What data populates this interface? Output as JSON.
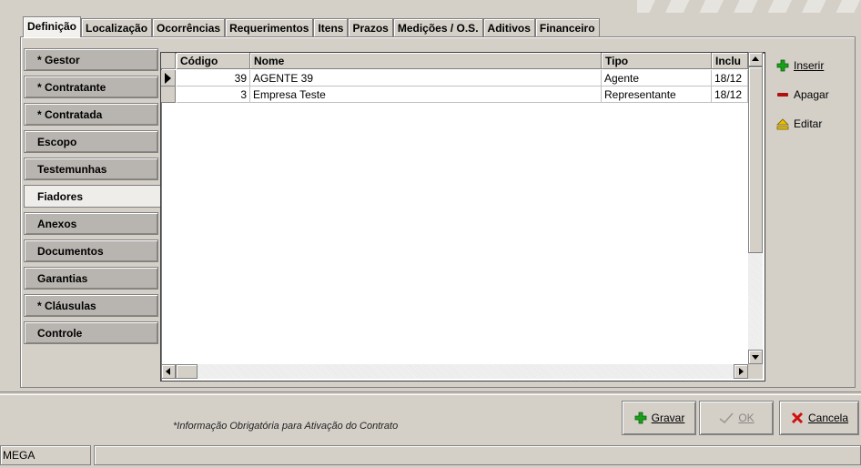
{
  "top_tabs": [
    "Definição",
    "Localização",
    "Ocorrências",
    "Requerimentos",
    "Itens",
    "Prazos",
    "Medições / O.S.",
    "Aditivos",
    "Financeiro"
  ],
  "side_tabs": [
    "* Gestor",
    "* Contratante",
    "* Contratada",
    "Escopo",
    "Testemunhas",
    "Fiadores",
    "Anexos",
    "Documentos",
    "Garantias",
    "* Cláusulas",
    "Controle"
  ],
  "active_side_tab": "Fiadores",
  "grid": {
    "columns": [
      "Código",
      "Nome",
      "Tipo",
      "Inclu"
    ],
    "rows": [
      [
        "39",
        "AGENTE 39",
        "Agente",
        "18/12"
      ],
      [
        "3",
        "Empresa Teste",
        "Representante",
        "18/12"
      ]
    ]
  },
  "side_actions": {
    "insert": "Inserir",
    "delete": "Apagar",
    "edit": "Editar"
  },
  "footer": {
    "note": "*Informação Obrigatória para Ativação do Contrato",
    "save": "Gravar",
    "ok": "OK",
    "cancel": "Cancela"
  },
  "status": {
    "label": "MEGA"
  },
  "colors": {
    "insert": "#1aa01a",
    "delete": "#b01010",
    "edit": "#c89a00",
    "cancel": "#d01010"
  },
  "icons": [
    "plus-icon",
    "minus-icon",
    "eject-icon",
    "check-icon",
    "x-icon",
    "row-pointer-icon"
  ]
}
